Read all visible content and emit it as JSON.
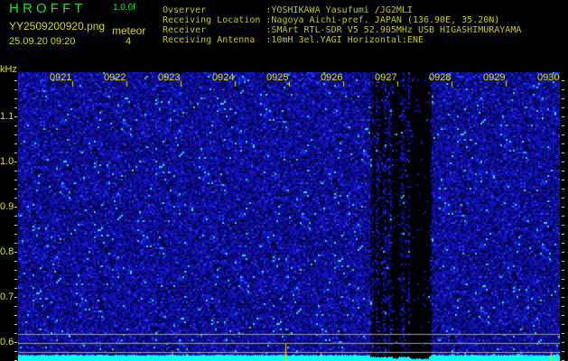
{
  "header": {
    "app_title": "H R O F F T",
    "version": "1.0.0f",
    "filename": "YY2509200920.png",
    "datetime": "25.09.20 09:20",
    "meteor_label": "meteor",
    "meteor_count": "4"
  },
  "info": [
    {
      "label": "Ovserver           ",
      "value": ":YOSHIKAWA Yasufumi /JG2MLI"
    },
    {
      "label": "Receiving Location ",
      "value": ":Nagoya Aichi-pref. JAPAN (136.90E, 35.20N)"
    },
    {
      "label": "Receiver           ",
      "value": ":SMArt RTL-SDR V5 52.905MHz USB HIGASHIMURAYAMA"
    },
    {
      "label": "Receiving Antenna  ",
      "value": ":10mH 3el.YAGI Horizontal:ENE"
    }
  ],
  "axis": {
    "unit": "kHz",
    "y_ticks": [
      "1.1",
      "1.0",
      "0.9",
      "0.8",
      "0.7",
      "0.6"
    ],
    "time_labels": [
      "0921",
      "0922",
      "0923",
      "0924",
      "0925",
      "0926",
      "0927",
      "0928",
      "0929",
      "0930"
    ]
  },
  "colors": {
    "noise": "#1010c0",
    "trace": "#00ffff",
    "label": "#e0e000"
  }
}
